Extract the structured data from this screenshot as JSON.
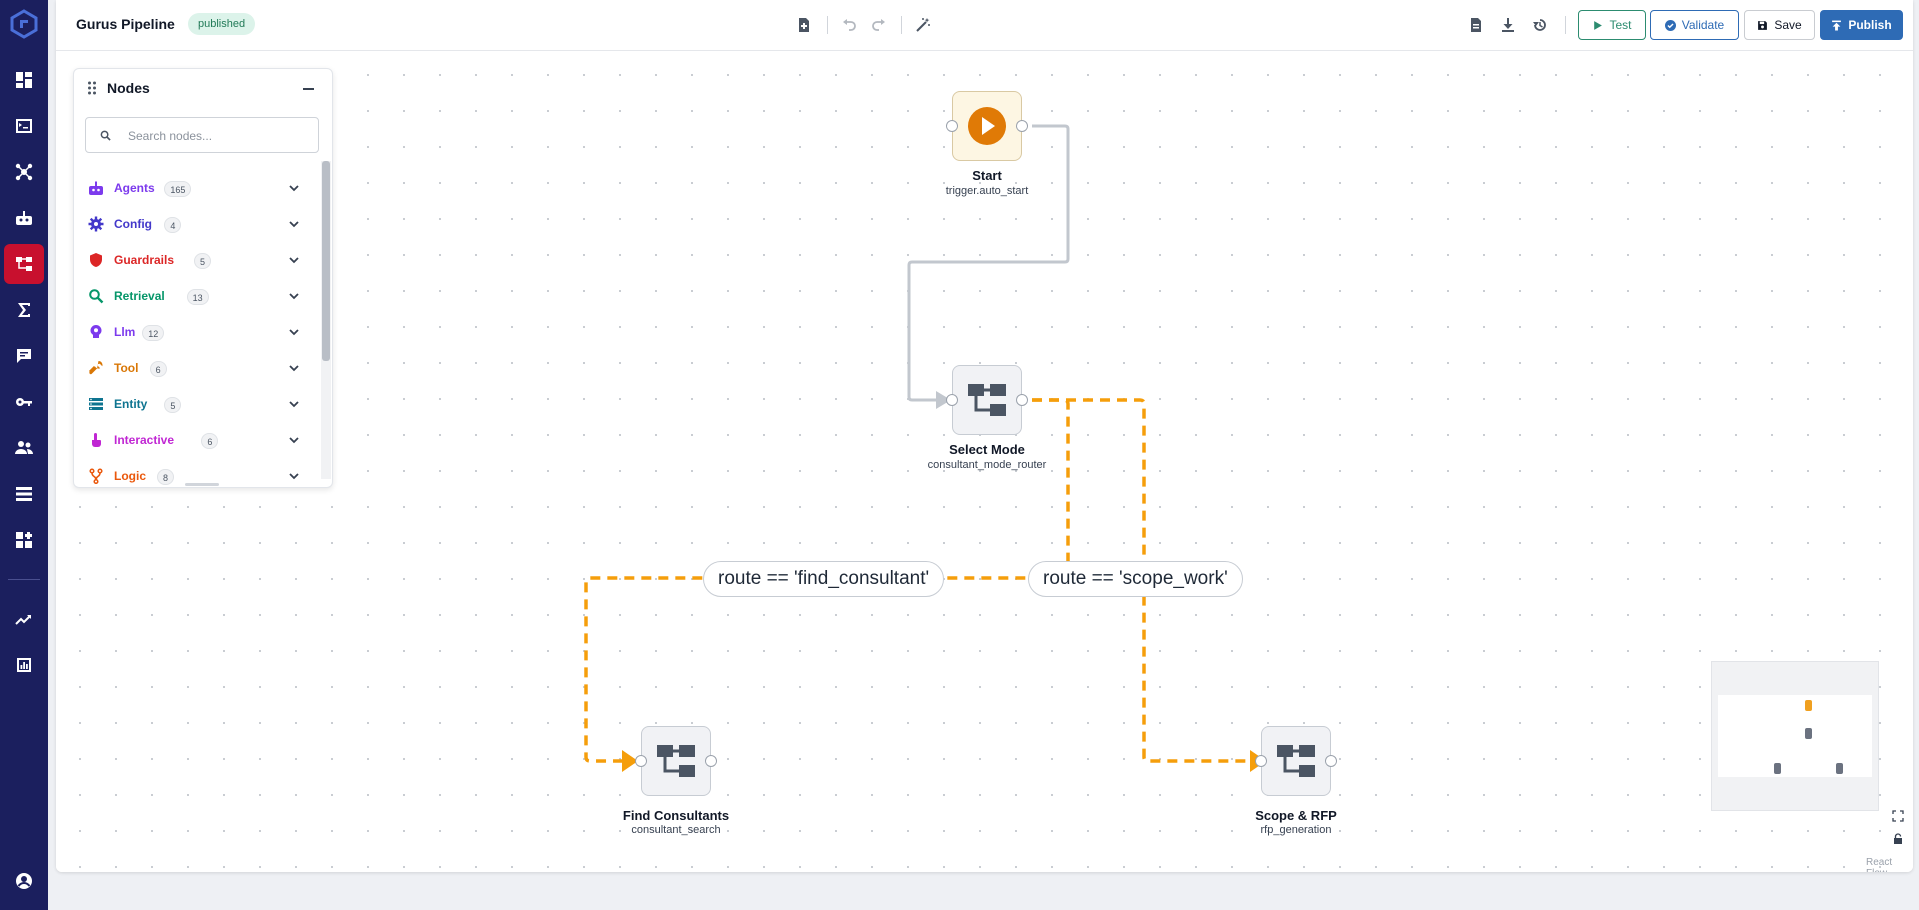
{
  "rail": {
    "items": [
      {
        "name": "dashboard-icon"
      },
      {
        "name": "terminal-icon"
      },
      {
        "name": "network-icon"
      },
      {
        "name": "robot-icon"
      },
      {
        "name": "pipeline-icon",
        "active": true
      },
      {
        "name": "sigma-icon"
      },
      {
        "name": "chat-icon"
      },
      {
        "name": "key-icon"
      },
      {
        "name": "users-icon"
      },
      {
        "name": "list-icon"
      },
      {
        "name": "apps-icon"
      },
      {
        "name": "trending-icon"
      },
      {
        "name": "bar-chart-icon"
      },
      {
        "name": "account-icon"
      }
    ],
    "accent": "#c8102e",
    "background": "#1b1f5e"
  },
  "header": {
    "title": "Gurus Pipeline",
    "status_badge": "published",
    "buttons": {
      "test": "Test",
      "validate": "Validate",
      "save": "Save",
      "publish": "Publish"
    }
  },
  "nodes_panel": {
    "title": "Nodes",
    "search_placeholder": "Search nodes...",
    "categories": [
      {
        "label": "Agents",
        "count": "165",
        "color": "#7c3aed",
        "icon": "robot-icon"
      },
      {
        "label": "Config",
        "count": "4",
        "color": "#4338ca",
        "icon": "gear-icon"
      },
      {
        "label": "Guardrails",
        "count": "5",
        "color": "#dc2626",
        "icon": "shield-icon"
      },
      {
        "label": "Retrieval",
        "count": "13",
        "color": "#059669",
        "icon": "search-icon"
      },
      {
        "label": "Llm",
        "count": "12",
        "color": "#7c3aed",
        "icon": "brain-icon"
      },
      {
        "label": "Tool",
        "count": "6",
        "color": "#d97706",
        "icon": "wrench-icon"
      },
      {
        "label": "Entity",
        "count": "5",
        "color": "#0e7490",
        "icon": "entity-icon"
      },
      {
        "label": "Interactive",
        "count": "6",
        "color": "#c026d3",
        "icon": "pointer-icon"
      },
      {
        "label": "Logic",
        "count": "8",
        "color": "#ea580c",
        "icon": "fork-icon"
      }
    ]
  },
  "flow": {
    "nodes": {
      "start": {
        "label": "Start",
        "sub": "trigger.auto_start"
      },
      "select_mode": {
        "label": "Select Mode",
        "sub": "consultant_mode_router"
      },
      "find_consultants": {
        "label": "Find Consultants",
        "sub": "consultant_search"
      },
      "scope_rfp": {
        "label": "Scope & RFP",
        "sub": "rfp_generation"
      }
    },
    "edges": {
      "find": "route == 'find_consultant'",
      "scope": "route == 'scope_work'"
    },
    "edge_color": "#f59e0b"
  },
  "attribution": "React Flow"
}
